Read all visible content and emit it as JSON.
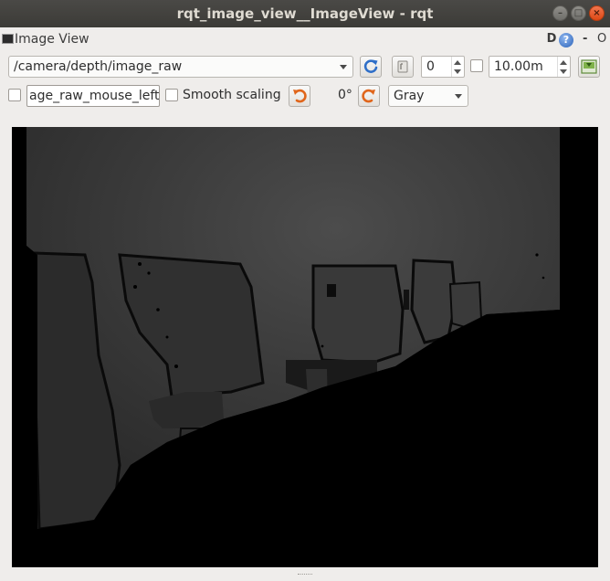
{
  "window": {
    "title": "rqt_image_view__ImageView - rqt",
    "buttons": {
      "minimize": "–",
      "maximize": "□",
      "close": "×"
    }
  },
  "dock": {
    "title": "Image View",
    "d_label": "D",
    "help_label": "?",
    "dash_label": "-",
    "o_label": "O"
  },
  "toolbar": {
    "topic": "/camera/depth/image_raw",
    "refresh_icon": "refresh-icon",
    "frame_index": "0",
    "timeout_enabled": false,
    "timeout_value": "10.00m",
    "save_icon": "save-image-icon"
  },
  "options": {
    "mouse_topic": "age_raw_mouse_left",
    "smooth_scaling_label": "Smooth scaling",
    "rotation": "0°",
    "color_scheme": "Gray"
  },
  "image": {
    "description_icon": "depth-image",
    "colors": {
      "background": "#000000",
      "far": "#4a4a4a",
      "mid": "#333333",
      "near": "#262626"
    }
  }
}
